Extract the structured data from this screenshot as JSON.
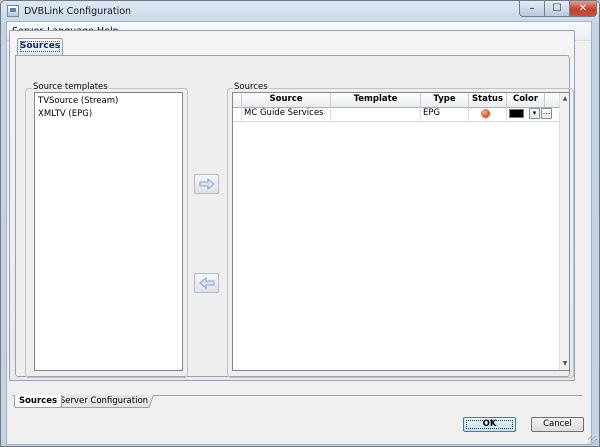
{
  "window": {
    "title": "DVBLink Configuration",
    "caption_buttons": {
      "minimize": "–",
      "maximize": "☐",
      "close": "✕"
    }
  },
  "menu": {
    "items": [
      "Server",
      "Language",
      "Help"
    ]
  },
  "inner_tab": {
    "label": "Sources"
  },
  "templates": {
    "group_label": "Source templates",
    "items": [
      "TVSource (Stream)",
      "XMLTV (EPG)"
    ]
  },
  "arrows": {
    "add_icon": "arrow-right-icon",
    "remove_icon": "arrow-left-icon"
  },
  "sources": {
    "group_label": "Sources",
    "columns": [
      "Source",
      "Template",
      "Type",
      "Status",
      "Color"
    ],
    "rows": [
      {
        "source": "MC Guide Services",
        "template": "",
        "type": "EPG",
        "status_color": "#e8531e",
        "color": "#000000",
        "more": "..."
      }
    ]
  },
  "bottom_tabs": [
    "Sources",
    "Server Configuration"
  ],
  "buttons": {
    "ok": "OK",
    "cancel": "Cancel"
  }
}
